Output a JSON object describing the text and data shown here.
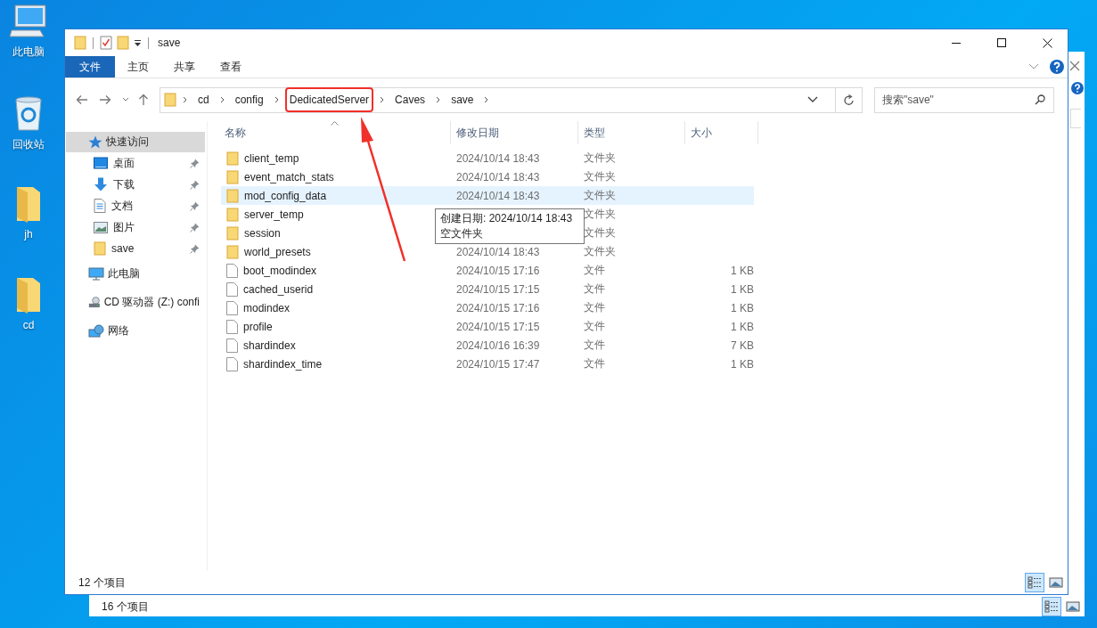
{
  "desktop_icons": [
    {
      "label": "此电脑",
      "kind": "computer"
    },
    {
      "label": "回收站",
      "kind": "recycle"
    },
    {
      "label": "jh",
      "kind": "folder"
    },
    {
      "label": "cd",
      "kind": "folder"
    }
  ],
  "background_window": {
    "status": "16 个项目",
    "view_buttons": [
      {
        "kind": "details",
        "selected": true
      },
      {
        "kind": "large",
        "selected": false
      }
    ]
  },
  "window": {
    "title": "save"
  },
  "ribbon_tabs": [
    {
      "label": "文件",
      "selected": true
    },
    {
      "label": "主页",
      "selected": false
    },
    {
      "label": "共享",
      "selected": false
    },
    {
      "label": "查看",
      "selected": false
    }
  ],
  "breadcrumbs": [
    {
      "label": "cd",
      "highlighted": false
    },
    {
      "label": "config",
      "highlighted": false
    },
    {
      "label": "DedicatedServer",
      "highlighted": true
    },
    {
      "label": "Caves",
      "highlighted": false
    },
    {
      "label": "save",
      "highlighted": false
    }
  ],
  "search": {
    "placeholder": "搜索\"save\""
  },
  "sidebar": {
    "items": [
      {
        "label": "快速访问",
        "kind": "star",
        "selected": true,
        "children": [
          {
            "label": "桌面",
            "kind": "desktop",
            "pinned": true
          },
          {
            "label": "下载",
            "kind": "download",
            "pinned": true
          },
          {
            "label": "文档",
            "kind": "document",
            "pinned": true
          },
          {
            "label": "图片",
            "kind": "pictures",
            "pinned": true
          },
          {
            "label": "save",
            "kind": "folder",
            "pinned": true
          }
        ]
      },
      {
        "label": "此电脑",
        "kind": "computer",
        "selected": false
      },
      {
        "label": "CD 驱动器 (Z:) confi",
        "kind": "drive",
        "selected": false
      },
      {
        "label": "网络",
        "kind": "network",
        "selected": false
      }
    ]
  },
  "table": {
    "columns": [
      {
        "label": "名称",
        "sorted": true
      },
      {
        "label": "修改日期",
        "sorted": false
      },
      {
        "label": "类型",
        "sorted": false
      },
      {
        "label": "大小",
        "sorted": false
      }
    ],
    "rows": [
      {
        "name": "client_temp",
        "date": "2024/10/14 18:43",
        "type": "文件夹",
        "kind": "folder",
        "hovered": false
      },
      {
        "name": "event_match_stats",
        "date": "2024/10/14 18:43",
        "type": "文件夹",
        "kind": "folder",
        "hovered": false
      },
      {
        "name": "mod_config_data",
        "date": "2024/10/14 18:43",
        "type": "文件夹",
        "kind": "folder",
        "hovered": true
      },
      {
        "name": "server_temp",
        "type": "文件夹",
        "kind": "folder",
        "hovered": false
      },
      {
        "name": "session",
        "type": "文件夹",
        "kind": "folder",
        "hovered": false
      },
      {
        "name": "world_presets",
        "date": "2024/10/14 18:43",
        "type": "文件夹",
        "kind": "folder",
        "hovered": false
      },
      {
        "name": "boot_modindex",
        "date": "2024/10/15 17:16",
        "type": "文件",
        "size": "1 KB",
        "kind": "file",
        "hovered": false
      },
      {
        "name": "cached_userid",
        "date": "2024/10/15 17:15",
        "type": "文件",
        "size": "1 KB",
        "kind": "file",
        "hovered": false
      },
      {
        "name": "modindex",
        "date": "2024/10/15 17:16",
        "type": "文件",
        "size": "1 KB",
        "kind": "file",
        "hovered": false
      },
      {
        "name": "profile",
        "date": "2024/10/15 17:15",
        "type": "文件",
        "size": "1 KB",
        "kind": "file",
        "hovered": false
      },
      {
        "name": "shardindex",
        "date": "2024/10/16 16:39",
        "type": "文件",
        "size": "7 KB",
        "kind": "file",
        "hovered": false
      },
      {
        "name": "shardindex_time",
        "date": "2024/10/15 17:47",
        "type": "文件",
        "size": "1 KB",
        "kind": "file",
        "hovered": false
      }
    ]
  },
  "tooltip": {
    "lines": [
      "创建日期: 2024/10/14 18:43",
      "空文件夹"
    ]
  },
  "status_bar": {
    "count": "12 个项目"
  },
  "view_buttons": [
    {
      "kind": "details",
      "selected": true
    },
    {
      "kind": "large",
      "selected": false
    }
  ]
}
